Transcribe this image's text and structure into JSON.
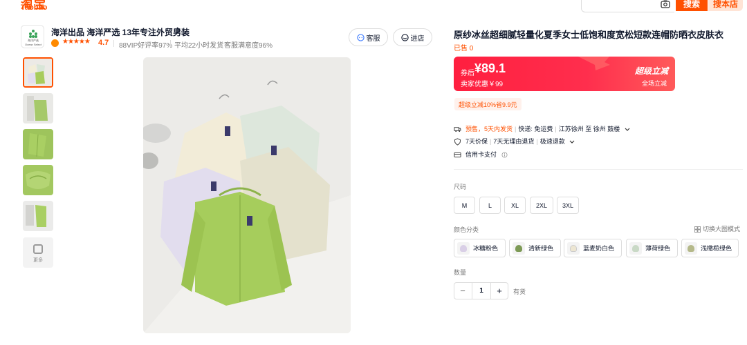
{
  "topbar": {
    "logo_cn": "淘宝",
    "logo_en": "Taobao",
    "search_button": "搜索",
    "shop_search_button": "搜本店"
  },
  "shop": {
    "name": "海洋出品 海洋严选 13年专注外贸男装",
    "logo_text_1": "海洋严选",
    "logo_text_2": "Ocean Select",
    "stars": "★★★★★",
    "rating": "4.7",
    "stats": [
      "88VIP好评率97%",
      "平均22小时发货",
      "客服满意度96%"
    ],
    "service_button": "客服",
    "enter_store_button": "进店"
  },
  "gallery": {
    "more_label": "更多"
  },
  "product": {
    "title": "原纱冰丝超细腻轻量化夏季女士低饱和度宽松短款连帽防晒衣皮肤衣",
    "sold": "已售 0",
    "coupon_label": "券后",
    "price": "¥89.1",
    "seller_price": "卖家优惠￥99",
    "super_tag": "超级立减",
    "store_wide": "全场立减",
    "promo_tag": "超级立减10%省9.9元",
    "shipping": {
      "presale": "预售，5天内发货",
      "fee": "快递: 免运费",
      "route": "江苏徐州 至 徐州 鼓楼"
    },
    "guarantees": [
      "7天价保",
      "7天无理由退货",
      "极速退款"
    ],
    "payment": "信用卡支付",
    "size_label": "尺码",
    "sizes": [
      "M",
      "L",
      "XL",
      "2XL",
      "3XL"
    ],
    "color_label": "颜色分类",
    "switch_view": "切换大图模式",
    "colors": [
      {
        "name": "冰糖粉色",
        "hex": "#d9cfe6"
      },
      {
        "name": "清新绿色",
        "hex": "#7d9a56"
      },
      {
        "name": "蓝麦奶白色",
        "hex": "#ede6d2"
      },
      {
        "name": "薄荷绿色",
        "hex": "#c9d9c6"
      },
      {
        "name": "浅橄榄绿色",
        "hex": "#b5b98a"
      }
    ],
    "quantity_label": "数量",
    "quantity": "1",
    "stock": "有货"
  },
  "colors": {
    "brand": "#ff5000",
    "price_red": "#ff2244"
  }
}
